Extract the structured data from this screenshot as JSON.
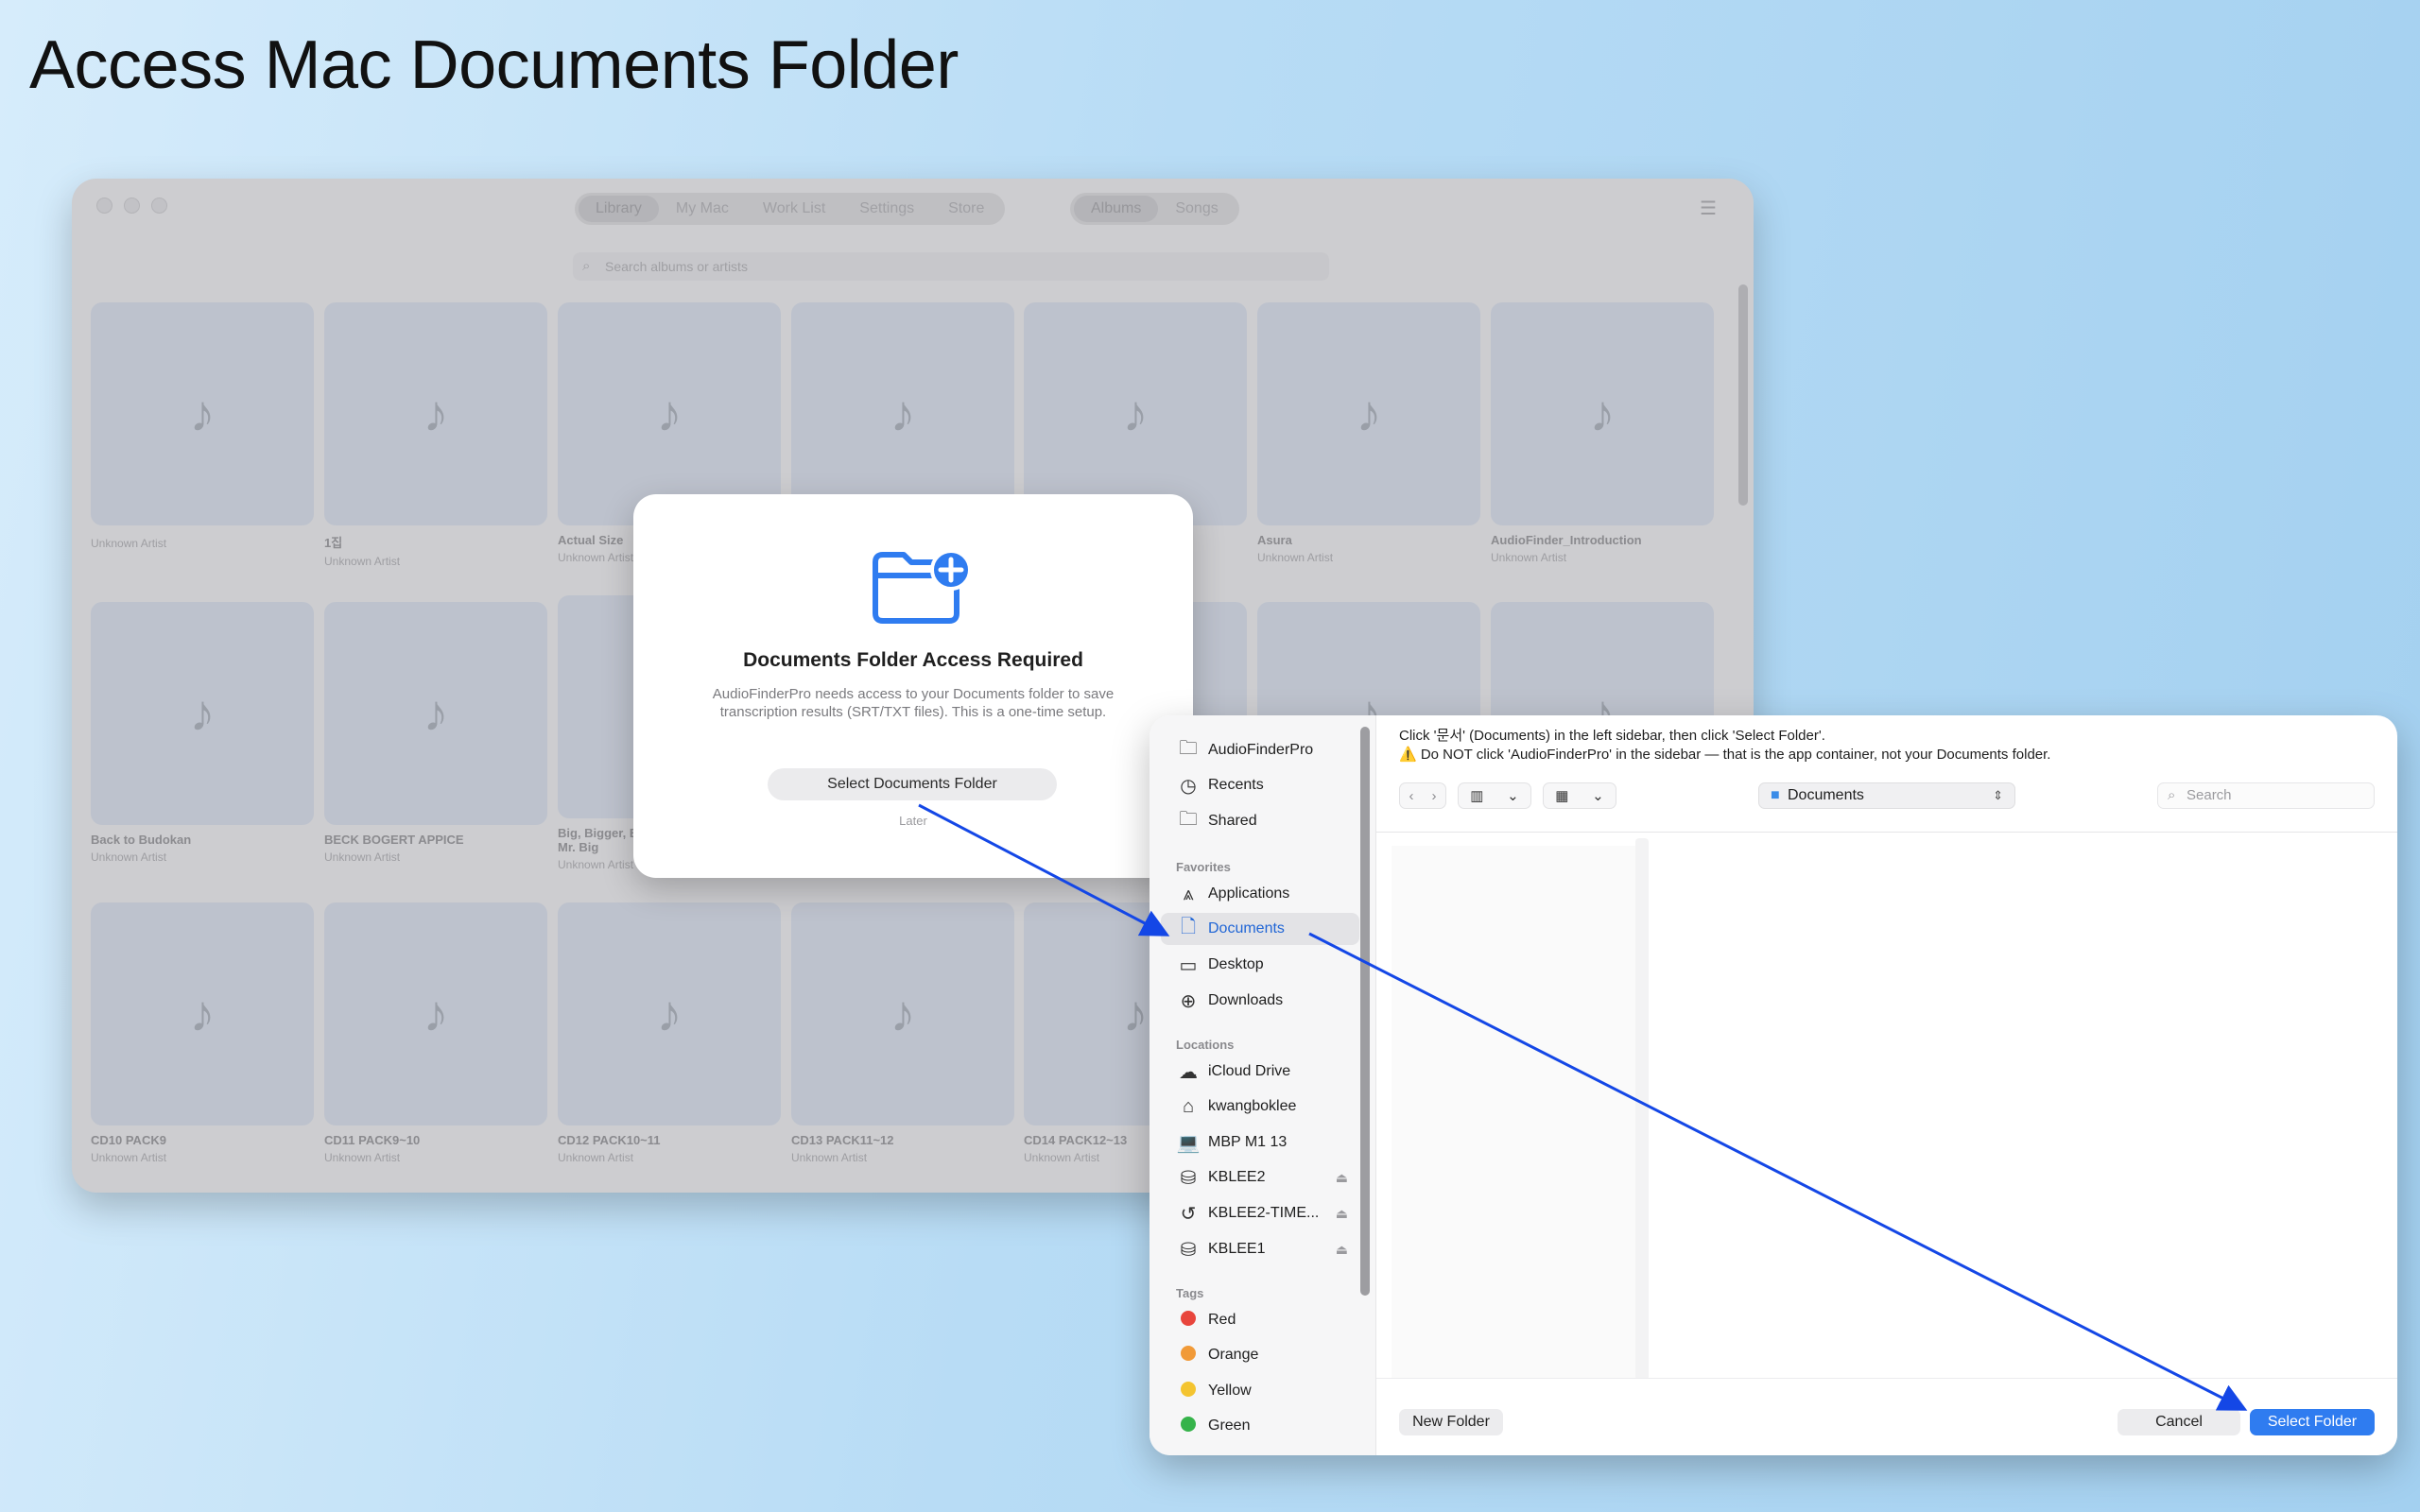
{
  "page": {
    "heading": "Access Mac Documents Folder"
  },
  "app": {
    "tabs": [
      "Library",
      "My Mac",
      "Work List",
      "Settings",
      "Store"
    ],
    "view_tabs": [
      "Albums",
      "Songs"
    ],
    "search_placeholder": "Search albums or artists",
    "music_glyph": "♪",
    "albums": [
      {
        "title": "",
        "artist": "Unknown Artist"
      },
      {
        "title": "1집",
        "artist": "Unknown Artist"
      },
      {
        "title": "Actual Size",
        "artist": "Unknown Artist"
      },
      {
        "title": "",
        "artist": ""
      },
      {
        "title": "",
        "artist": ""
      },
      {
        "title": "Asura",
        "artist": "Unknown Artist"
      },
      {
        "title": "AudioFinder_Introduction",
        "artist": "Unknown Artist"
      },
      {
        "title": "Back to Budokan",
        "artist": "Unknown Artist"
      },
      {
        "title": "BECK BOGERT APPICE",
        "artist": "Unknown Artist"
      },
      {
        "title": "Big, Bigger, B",
        "title2": "Mr. Big",
        "artist": "Unknown Artist"
      },
      {
        "title": "",
        "artist": ""
      },
      {
        "title": "",
        "artist": ""
      },
      {
        "title": "",
        "artist": ""
      },
      {
        "title": "",
        "artist": ""
      },
      {
        "title": "CD10 PACK9",
        "artist": "Unknown Artist"
      },
      {
        "title": "CD11 PACK9~10",
        "artist": "Unknown Artist"
      },
      {
        "title": "CD12 PACK10~11",
        "artist": "Unknown Artist"
      },
      {
        "title": "CD13 PACK11~12",
        "artist": "Unknown Artist"
      },
      {
        "title": "CD14 PACK12~13",
        "artist": "Unknown Artist"
      }
    ]
  },
  "modal": {
    "title": "Documents Folder Access Required",
    "description": "AudioFinderPro needs access to your Documents folder to save transcription results (SRT/TXT files). This is a one-time setup.",
    "primary_button": "Select Documents Folder",
    "later_link": "Later"
  },
  "dialog": {
    "instruction_line1": "Click '문서' (Documents) in the left sidebar, then click 'Select Folder'.",
    "instruction_line2": "⚠️ Do NOT click 'AudioFinderPro' in the sidebar — that is the app container, not your Documents folder.",
    "path": "Documents",
    "search_placeholder": "Search",
    "sidebar_top": [
      {
        "label": "AudioFinderPro",
        "icon": "folder-icon"
      },
      {
        "label": "Recents",
        "icon": "clock-icon"
      },
      {
        "label": "Shared",
        "icon": "shared-folder-icon"
      }
    ],
    "favorites_header": "Favorites",
    "favorites": [
      {
        "label": "Applications",
        "icon": "applications-icon"
      },
      {
        "label": "Documents",
        "icon": "document-icon"
      },
      {
        "label": "Desktop",
        "icon": "desktop-icon"
      },
      {
        "label": "Downloads",
        "icon": "download-icon"
      }
    ],
    "locations_header": "Locations",
    "locations": [
      {
        "label": "iCloud Drive",
        "icon": "cloud-icon"
      },
      {
        "label": "kwangboklee",
        "icon": "home-icon"
      },
      {
        "label": "MBP M1 13",
        "icon": "laptop-icon"
      },
      {
        "label": "KBLEE2",
        "icon": "drive-icon"
      },
      {
        "label": "KBLEE2-TIME...",
        "icon": "time-machine-icon"
      },
      {
        "label": "KBLEE1",
        "icon": "drive-icon"
      }
    ],
    "tags_header": "Tags",
    "tags": [
      {
        "label": "Red",
        "color": "#e8453c"
      },
      {
        "label": "Orange",
        "color": "#f19a38"
      },
      {
        "label": "Yellow",
        "color": "#f4c430"
      },
      {
        "label": "Green",
        "color": "#35b34a"
      }
    ],
    "new_folder": "New Folder",
    "cancel": "Cancel",
    "select_folder": "Select Folder"
  },
  "colors": {
    "accent": "#2f7cf0",
    "arrow": "#1447e6"
  }
}
